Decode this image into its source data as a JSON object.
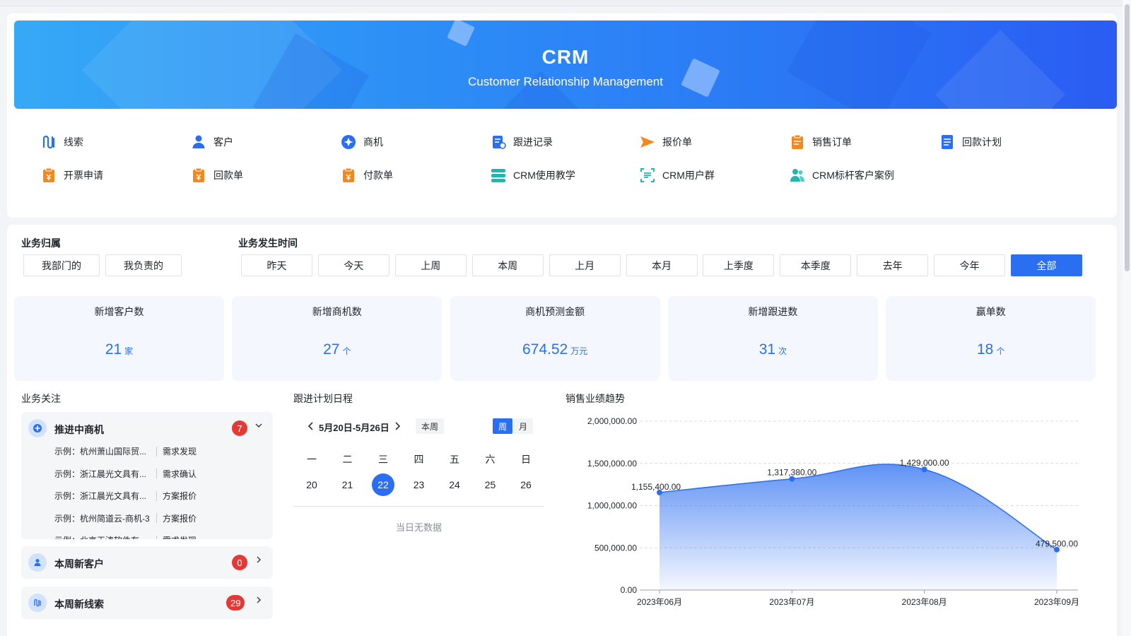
{
  "banner": {
    "title": "CRM",
    "subtitle": "Customer Relationship Management"
  },
  "quick_links": [
    {
      "label": "线索",
      "icon": "clue-icon",
      "color": "#2a6ef2"
    },
    {
      "label": "客户",
      "icon": "customer-icon",
      "color": "#2a6ef2"
    },
    {
      "label": "商机",
      "icon": "opportunity-icon",
      "color": "#2a6ef2"
    },
    {
      "label": "跟进记录",
      "icon": "follow-record-icon",
      "color": "#2a6ef2"
    },
    {
      "label": "报价单",
      "icon": "quote-icon",
      "color": "#f5871f"
    },
    {
      "label": "销售订单",
      "icon": "sales-order-icon",
      "color": "#f5871f"
    },
    {
      "label": "回款计划",
      "icon": "payment-plan-icon",
      "color": "#2a6ef2"
    },
    {
      "label": "开票申请",
      "icon": "invoice-icon",
      "color": "#f5871f"
    },
    {
      "label": "回款单",
      "icon": "receipt-icon",
      "color": "#f5871f"
    },
    {
      "label": "付款单",
      "icon": "payment-icon",
      "color": "#f5871f"
    },
    {
      "label": "CRM使用教学",
      "icon": "tutorial-icon",
      "color": "#1fb8b0"
    },
    {
      "label": "CRM用户群",
      "icon": "user-group-icon",
      "color": "#1fb8b0"
    },
    {
      "label": "CRM标杆客户案例",
      "icon": "case-icon",
      "color": "#1fb8b0"
    }
  ],
  "filters": {
    "ownership_label": "业务归属",
    "ownership": [
      "我部门的",
      "我负责的"
    ],
    "time_label": "业务发生时间",
    "time": [
      "昨天",
      "今天",
      "上周",
      "本周",
      "上月",
      "本月",
      "上季度",
      "本季度",
      "去年",
      "今年",
      "全部"
    ],
    "time_selected": "全部"
  },
  "stats": [
    {
      "title": "新增客户数",
      "value": "21",
      "unit": "家"
    },
    {
      "title": "新增商机数",
      "value": "27",
      "unit": "个"
    },
    {
      "title": "商机预测金额",
      "value": "674.52",
      "unit": "万元"
    },
    {
      "title": "新增跟进数",
      "value": "31",
      "unit": "次"
    },
    {
      "title": "赢单数",
      "value": "18",
      "unit": "个"
    }
  ],
  "focus": {
    "label": "业务关注",
    "sections": [
      {
        "title": "推进中商机",
        "count": "7",
        "expanded": true,
        "rows": [
          {
            "name": "示例：杭州萧山国际贸...",
            "stage": "需求发现"
          },
          {
            "name": "示例：浙江晨光文具有...",
            "stage": "需求确认"
          },
          {
            "name": "示例：浙江晨光文具有...",
            "stage": "方案报价"
          },
          {
            "name": "示例：杭州简道云-商机-3",
            "stage": "方案报价"
          },
          {
            "name": "示例：北京天涛软件有...",
            "stage": "需求发现"
          }
        ]
      },
      {
        "title": "本周新客户",
        "count": "0",
        "expanded": false
      },
      {
        "title": "本周新线索",
        "count": "29",
        "expanded": false
      }
    ]
  },
  "calendar": {
    "label": "跟进计划日程",
    "range": "5月20日-5月26日",
    "this_week": "本周",
    "view_week": "周",
    "view_month": "月",
    "weekdays": [
      "一",
      "二",
      "三",
      "四",
      "五",
      "六",
      "日"
    ],
    "days": [
      "20",
      "21",
      "22",
      "23",
      "24",
      "25",
      "26"
    ],
    "selected_day": "22",
    "empty_text": "当日无数据"
  },
  "chart_data": {
    "type": "area",
    "title": "销售业绩趋势",
    "x": [
      "2023年06月",
      "2023年07月",
      "2023年08月",
      "2023年09月"
    ],
    "values": [
      1155400,
      1317380,
      1429000,
      479500
    ],
    "data_labels": [
      "1,155,400.00",
      "1,317,380.00",
      "1,429,000.00",
      "479,500.00"
    ],
    "y_ticks": [
      "0.00",
      "500,000.00",
      "1,000,000.00",
      "1,500,000.00",
      "2,000,000.00"
    ],
    "ylim": [
      0,
      2000000
    ],
    "grid": true,
    "color": "#2a6ef2"
  }
}
